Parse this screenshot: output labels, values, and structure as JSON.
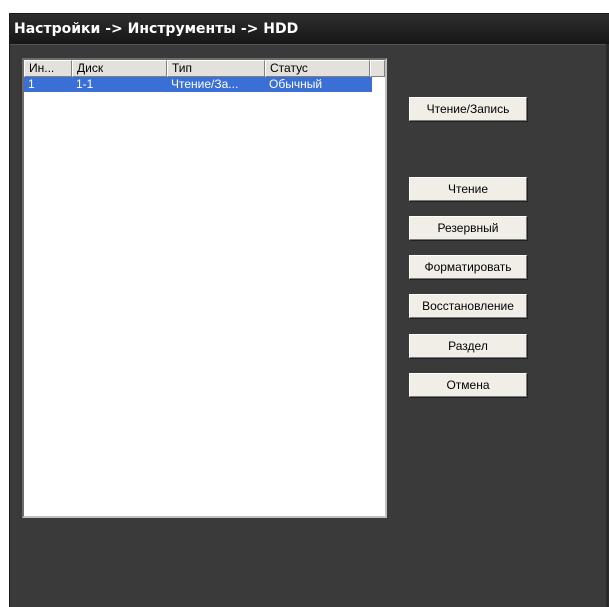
{
  "window": {
    "title": "Настройки -> Инструменты -> HDD"
  },
  "table": {
    "columns": [
      "Ин...",
      "Диск",
      "Тип",
      "Статус"
    ],
    "rows": [
      {
        "index": "1",
        "disk": "1-1",
        "type": "Чтение/За...",
        "status": "Обычный"
      }
    ]
  },
  "buttons": {
    "read_write": "Чтение/Запись",
    "read": "Чтение",
    "backup": "Резервный",
    "format": "Форматировать",
    "restore": "Восстановление",
    "partition": "Раздел",
    "cancel": "Отмена"
  },
  "colors": {
    "background": "#3a3a3a",
    "titlebar": "#161616",
    "selection": "#3a6fd6",
    "button": "#f0eee6"
  }
}
